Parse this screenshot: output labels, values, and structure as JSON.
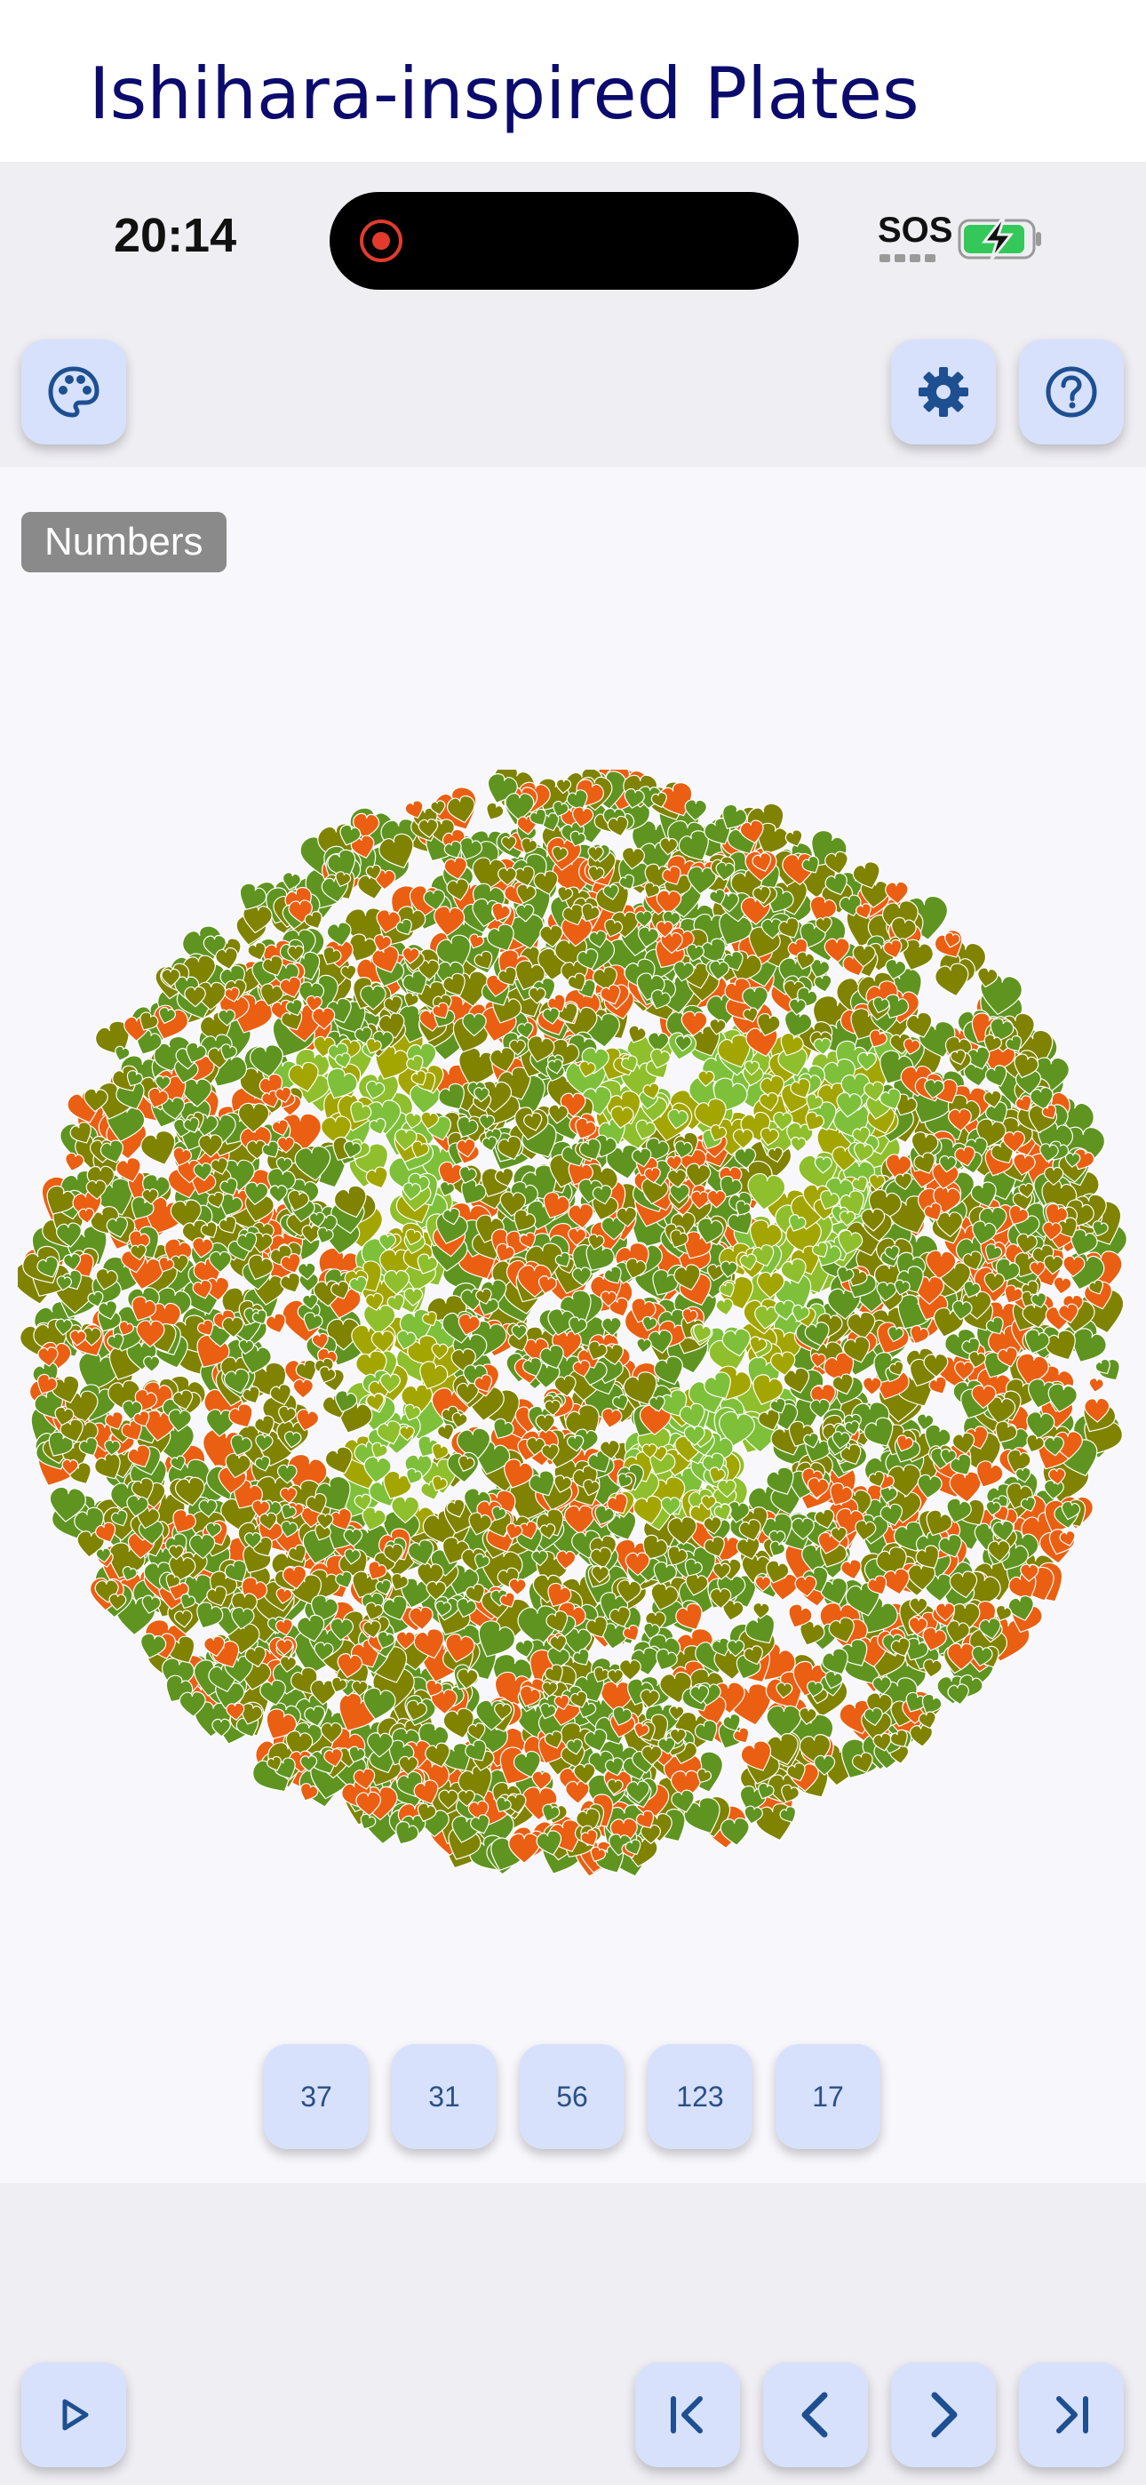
{
  "app": {
    "title": "Ishihara-inspired Plates"
  },
  "status_bar": {
    "time": "20:14",
    "carrier": "SOS",
    "battery": "charging"
  },
  "toolbar": {
    "left_icon": "palette-icon",
    "right_icons": [
      "gear-icon",
      "help-icon"
    ]
  },
  "plate": {
    "category": "Numbers",
    "hidden_number": "17",
    "colors": {
      "background_dots": [
        "#5f9420",
        "#7f8300",
        "#ea5f12"
      ],
      "figure_dots": [
        "#8fbf2c",
        "#a3a600",
        "#7ec03a"
      ]
    }
  },
  "answers": [
    "37",
    "31",
    "56",
    "123",
    "17"
  ],
  "navigation": {
    "play_icon": "play-icon",
    "buttons": [
      "first-icon",
      "previous-icon",
      "next-icon",
      "last-icon"
    ]
  },
  "accent": "#1d4f91",
  "button_bg": "#d7e1fb"
}
